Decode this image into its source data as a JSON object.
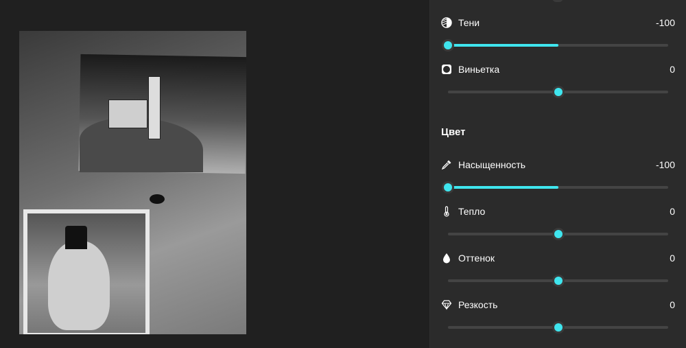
{
  "sections": {
    "color_title": "Цвет"
  },
  "sliders": [
    {
      "id": "shadows",
      "label": "Тени",
      "value": "-100",
      "icon": "shadows-icon",
      "level": 0.0
    },
    {
      "id": "vignette",
      "label": "Виньетка",
      "value": "0",
      "icon": "vignette-icon",
      "level": 0.5
    },
    {
      "id": "saturation",
      "label": "Насыщенность",
      "value": "-100",
      "icon": "eyedropper-icon",
      "level": 0.0
    },
    {
      "id": "warmth",
      "label": "Тепло",
      "value": "0",
      "icon": "thermometer-icon",
      "level": 0.5
    },
    {
      "id": "tint",
      "label": "Оттенок",
      "value": "0",
      "icon": "droplet-icon",
      "level": 0.5
    },
    {
      "id": "sharpness",
      "label": "Резкость",
      "value": "0",
      "icon": "diamond-icon",
      "level": 0.5
    }
  ],
  "colors": {
    "accent": "#3fe5ee",
    "panel": "#2b2b2b",
    "track": "#444444"
  }
}
